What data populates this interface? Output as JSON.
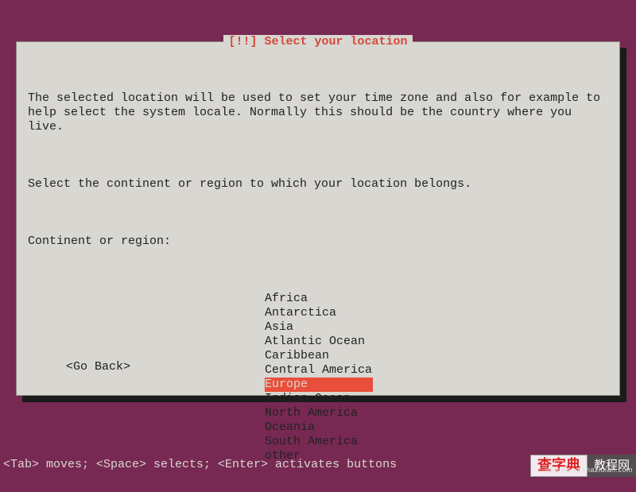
{
  "dialog": {
    "priority": "[!!]",
    "title": "Select your location",
    "para1": "The selected location will be used to set your time zone and also for example to help select the system locale. Normally this should be the country where you live.",
    "para2": "Select the continent or region to which your location belongs.",
    "prompt": "Continent or region:",
    "items": [
      "Africa",
      "Antarctica",
      "Asia",
      "Atlantic Ocean",
      "Caribbean",
      "Central America",
      "Europe",
      "Indian Ocean",
      "North America",
      "Oceania",
      "South America",
      "other"
    ],
    "selected_index": 6,
    "go_back": "<Go Back>"
  },
  "footer": "<Tab> moves; <Space> selects; <Enter> activates buttons",
  "watermark": {
    "text1": "查字典",
    "text2": "教程网",
    "sub": "jiaocheng.chazidian.com"
  }
}
